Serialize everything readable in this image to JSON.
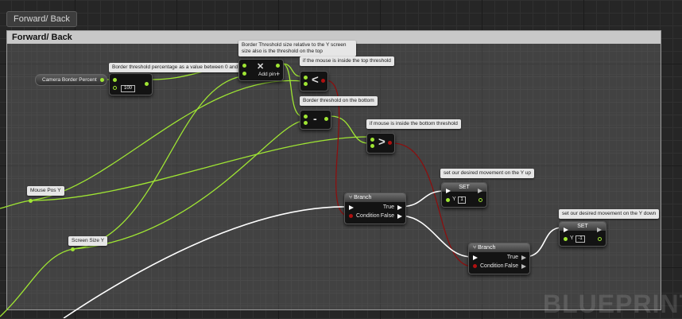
{
  "tab": {
    "label": "Forward/ Back"
  },
  "comment": {
    "title": "Forward/ Back"
  },
  "variables": {
    "camera_border_percent": "Camera Border Percent",
    "mouse_pos_y": "Mouse Pos Y",
    "screen_size_y": "Screen Size Y"
  },
  "comments": {
    "border_threshold_pct": "Border threshold percentage as a value between 0 and 1",
    "border_threshold_size": "Border Threshold size relative to the Y screen size also is the threshold on the top",
    "inside_top": "if the mouse is inside the top threshold",
    "threshold_bottom": "Border threshold on the bottom",
    "inside_bottom": "if mouse is inside the bottom threshold",
    "move_up": "set our desired movement on the Y up",
    "move_down": "set our desired movement on the Y down"
  },
  "nodes": {
    "multiply_default": "100",
    "add_pin": "Add pin",
    "add_pin_plus": "+",
    "less_op": "<",
    "minus_op": "-",
    "greater_op": ">",
    "branch_title": "Branch",
    "branch_condition": "Condition",
    "branch_true": "True",
    "branch_false": "False",
    "set_title": "SET",
    "set_y_label": "Y",
    "set_up_value": "1",
    "set_down_value": "-1"
  },
  "colors": {
    "float_wire": "#9fe533",
    "bool_wire": "#8b0f0f",
    "exec_wire": "#ffffff"
  },
  "watermark": "BLUEPRINT"
}
